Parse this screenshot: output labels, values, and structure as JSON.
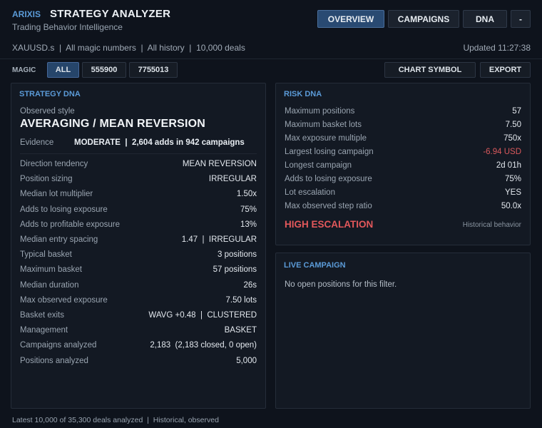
{
  "header": {
    "brand": "ARIXIS",
    "title": "STRATEGY ANALYZER",
    "subtitle": "Trading Behavior Intelligence",
    "nav": [
      "OVERVIEW",
      "CAMPAIGNS",
      "DNA",
      "-"
    ]
  },
  "filters": {
    "summary": "XAUUSD.s  |  All magic numbers  |  All history  |  10,000 deals",
    "updated": "Updated 11:27:38"
  },
  "magic": {
    "label": "MAGIC",
    "options": [
      "ALL",
      "555900",
      "7755013"
    ],
    "selected": "ALL"
  },
  "toolbar": {
    "chart_symbol": "CHART SYMBOL",
    "export": "EXPORT"
  },
  "strategy_dna": {
    "title": "STRATEGY DNA",
    "observed_label": "Observed style",
    "style": "AVERAGING / MEAN REVERSION",
    "evidence_label": "Evidence",
    "evidence_value": "MODERATE  |  2,604 adds in 942 campaigns",
    "rows": [
      {
        "k": "Direction tendency",
        "v": "MEAN REVERSION"
      },
      {
        "k": "Position sizing",
        "v": "IRREGULAR"
      },
      {
        "k": "Median lot multiplier",
        "v": "1.50x"
      },
      {
        "k": "Adds to losing exposure",
        "v": "75%"
      },
      {
        "k": "Adds to profitable exposure",
        "v": "13%"
      },
      {
        "k": "Median entry spacing",
        "v": "1.47  |  IRREGULAR"
      },
      {
        "k": "Typical basket",
        "v": "3 positions"
      },
      {
        "k": "Maximum basket",
        "v": "57 positions"
      },
      {
        "k": "Median duration",
        "v": "26s"
      },
      {
        "k": "Max observed exposure",
        "v": "7.50 lots"
      },
      {
        "k": "Basket exits",
        "v": "WAVG +0.48  |  CLUSTERED"
      },
      {
        "k": "Management",
        "v": "BASKET"
      },
      {
        "k": "Campaigns analyzed",
        "v": "2,183  (2,183 closed, 0 open)"
      },
      {
        "k": "Positions analyzed",
        "v": "5,000"
      }
    ]
  },
  "risk_dna": {
    "title": "RISK DNA",
    "rows": [
      {
        "k": "Maximum positions",
        "v": "57"
      },
      {
        "k": "Maximum basket lots",
        "v": "7.50"
      },
      {
        "k": "Max exposure multiple",
        "v": "750x"
      },
      {
        "k": "Largest losing campaign",
        "v": "-6.94 USD"
      },
      {
        "k": "Longest campaign",
        "v": "2d 01h"
      },
      {
        "k": "Adds to losing exposure",
        "v": "75%"
      },
      {
        "k": "Lot escalation",
        "v": "YES"
      },
      {
        "k": "Max observed step ratio",
        "v": "50.0x"
      }
    ],
    "verdict": "HIGH ESCALATION",
    "verdict_note": "Historical behavior",
    "negative_color": "#d9595c"
  },
  "live_campaign": {
    "title": "LIVE CAMPAIGN",
    "empty": "No open positions for this filter."
  },
  "footer": "Latest 10,000 of 35,300 deals analyzed  |  Historical, observed"
}
